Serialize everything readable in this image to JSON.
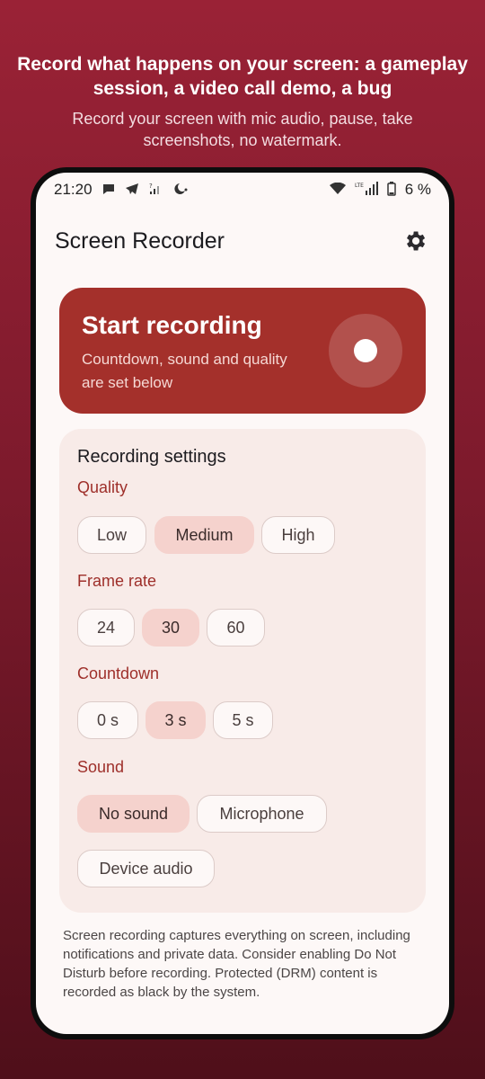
{
  "promo": {
    "title": "Record what happens on your screen: a gameplay session, a video call demo, a bug",
    "subtitle": "Record your screen with mic audio, pause, take screenshots, no watermark."
  },
  "status_bar": {
    "time": "21:20",
    "battery": "6 %",
    "network": "LTE",
    "icons": [
      "chat-icon",
      "telegram-icon",
      "no-signal-icon",
      "night-mode-icon",
      "wifi-icon",
      "signal-icon",
      "battery-icon"
    ]
  },
  "app": {
    "title": "Screen Recorder",
    "settings_icon": "gear-icon"
  },
  "start_card": {
    "title": "Start recording",
    "description": "Countdown, sound and quality are set below",
    "button_icon": "record-icon"
  },
  "settings": {
    "title": "Recording settings",
    "quality": {
      "label": "Quality",
      "options": [
        "Low",
        "Medium",
        "High"
      ],
      "selected": "Medium"
    },
    "frame_rate": {
      "label": "Frame rate",
      "options": [
        "24",
        "30",
        "60"
      ],
      "selected": "30"
    },
    "countdown": {
      "label": "Countdown",
      "options": [
        "0 s",
        "3 s",
        "5 s"
      ],
      "selected": "3 s"
    },
    "sound": {
      "label": "Sound",
      "options": [
        "No sound",
        "Microphone",
        "Device audio"
      ],
      "selected": "No sound"
    }
  },
  "disclaimer": "Screen recording captures everything on screen, including notifications and private data. Consider enabling Do Not Disturb before recording. Protected (DRM) content is recorded as black by the system.",
  "colors": {
    "background_top": "#9a2236",
    "background_bottom": "#4f0f1a",
    "accent": "#a4302b",
    "chip_selected": "#f5d2cd",
    "label_color": "#9e2f2a",
    "surface": "#fdf8f7",
    "card": "#f8ebe8"
  }
}
